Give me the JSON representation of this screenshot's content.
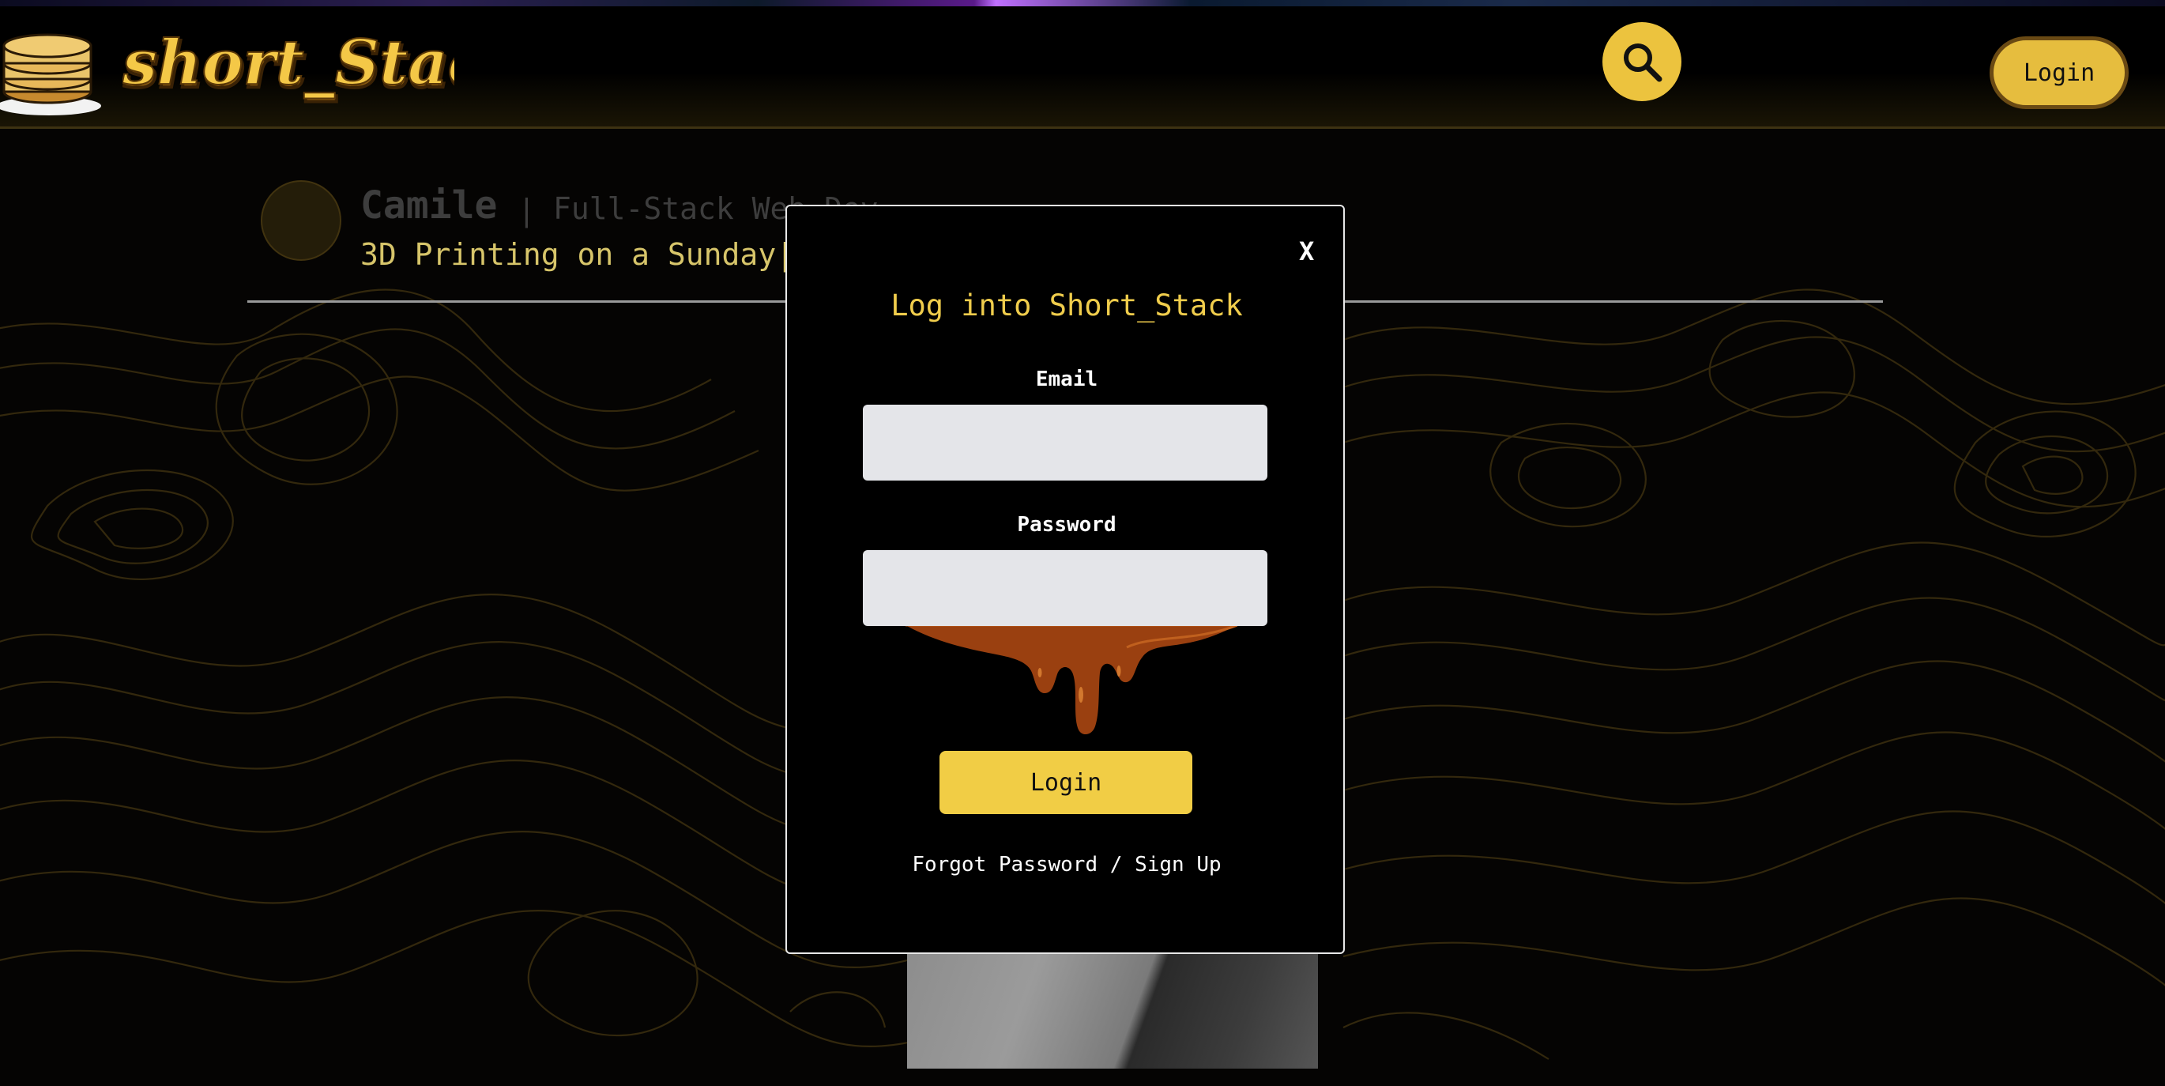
{
  "brand": {
    "logo_text": "short_Stack"
  },
  "header": {
    "login_label": "Login"
  },
  "profile": {
    "name": "Camile",
    "separator": "|",
    "role": "Full-Stack Web Dev...",
    "post_title": "3D Printing on a Sunday",
    "post_separator": "|"
  },
  "modal": {
    "close_label": "X",
    "title": "Log into Short_Stack",
    "email_label": "Email",
    "email_value": "",
    "password_label": "Password",
    "password_value": "",
    "login_label": "Login",
    "forgot_label": "Forgot Password",
    "links_separator": " / ",
    "signup_label": "Sign Up"
  },
  "colors": {
    "accent": "#ecc33e",
    "title": "#f0cd4c",
    "syrup": "#9a4010",
    "topo_lines": "#4a3a12"
  },
  "icons": {
    "search": "search-icon",
    "logo": "pancake-stack-icon",
    "syrup": "syrup-drip"
  }
}
